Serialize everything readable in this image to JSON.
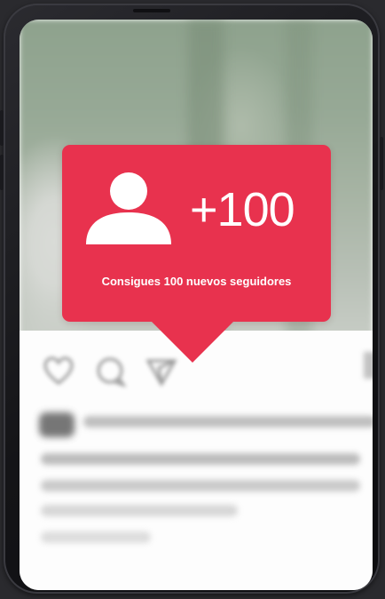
{
  "notification": {
    "count": "+100",
    "message": "Consigues 100 nuevos seguidores",
    "accent_color": "#e8324e",
    "icon": "person-icon"
  },
  "post": {
    "action_icons": [
      "heart-icon",
      "comment-icon",
      "share-icon",
      "bookmark-icon"
    ]
  }
}
